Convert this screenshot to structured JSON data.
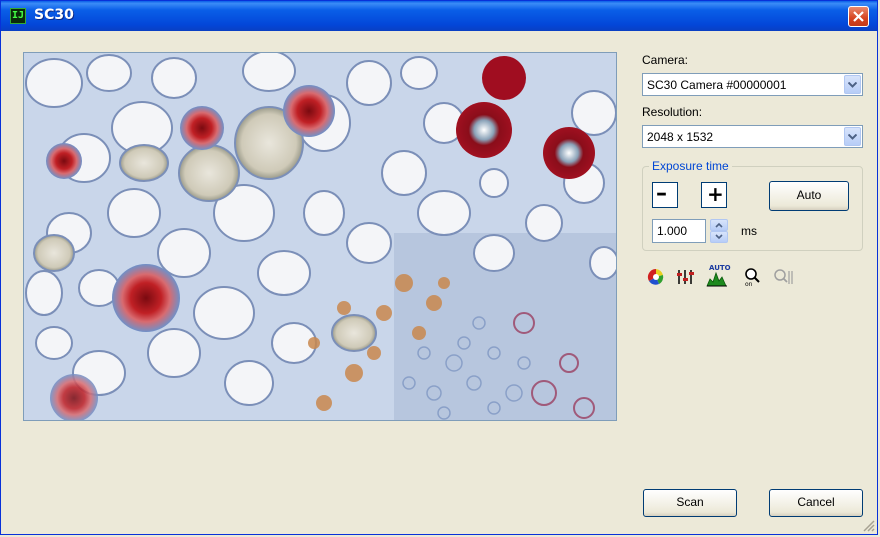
{
  "window": {
    "title": "SC30"
  },
  "camera": {
    "label": "Camera:",
    "value": "SC30 Camera #00000001"
  },
  "resolution": {
    "label": "Resolution:",
    "value": "2048 x 1532"
  },
  "exposure": {
    "group_title": "Exposure time",
    "minus_label": "–",
    "plus_label": "+",
    "auto_label": "Auto",
    "value": "1.000",
    "unit": "ms"
  },
  "toolbar": {
    "auto_icon_text": "AUTO"
  },
  "footer": {
    "scan_label": "Scan",
    "cancel_label": "Cancel"
  },
  "icons": [
    "color-wheel-icon",
    "levels-adjust-icon",
    "auto-histogram-icon",
    "magnifier-on-icon",
    "magnifier-disabled-icon",
    "size-grip-icon",
    "close-icon",
    "dropdown-arrow-icon"
  ],
  "colors": {
    "titlebar": "#0a5fe8",
    "face": "#ece9d8",
    "group_title": "#0046d5",
    "close": "#d6431f"
  }
}
